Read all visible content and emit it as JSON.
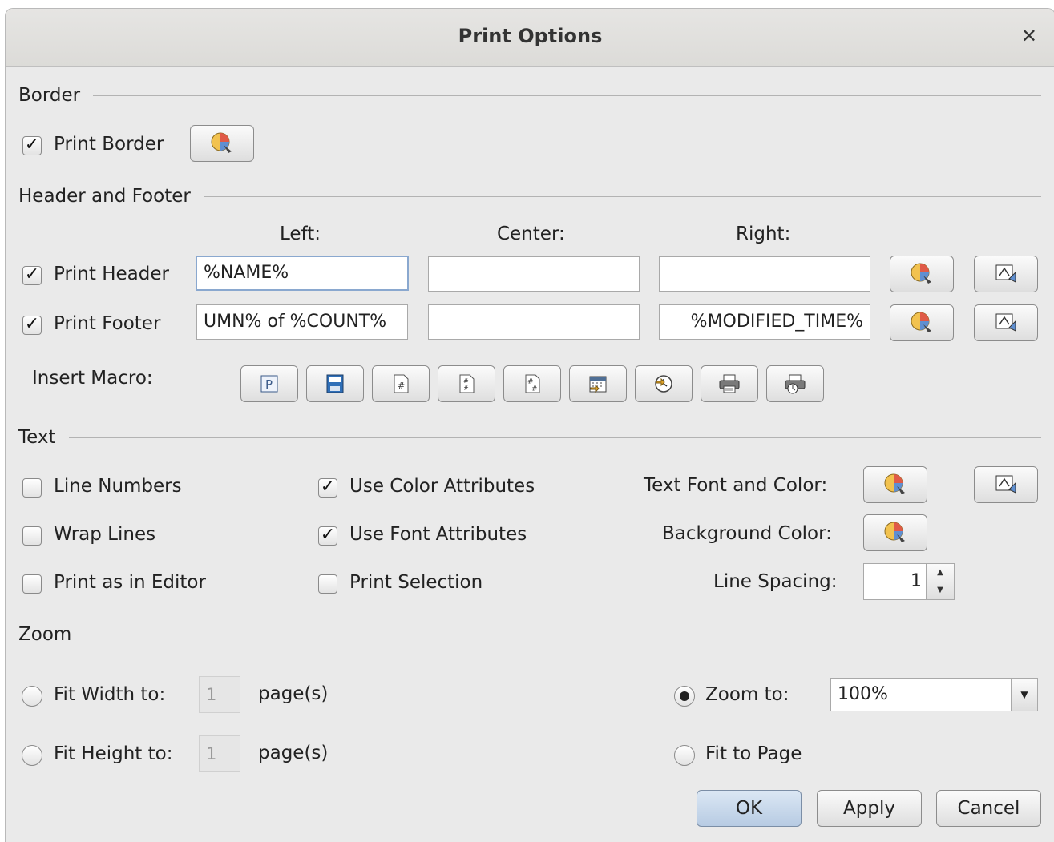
{
  "dialog": {
    "title": "Print Options",
    "close_glyph": "✕"
  },
  "border": {
    "section_label": "Border",
    "print_border": "Print Border",
    "print_border_checked": true
  },
  "header_footer": {
    "section_label": "Header and Footer",
    "col_left": "Left:",
    "col_center": "Center:",
    "col_right": "Right:",
    "print_header": "Print Header",
    "print_header_checked": true,
    "header_left": "%NAME%",
    "header_center": "",
    "header_right": "",
    "print_footer": "Print Footer",
    "print_footer_checked": true,
    "footer_left": "UMN% of %COUNT%",
    "footer_center": "",
    "footer_right": "%MODIFIED_TIME%",
    "insert_macro": "Insert Macro:",
    "macro_icons": [
      "macro-p-icon",
      "macro-save-icon",
      "macro-page-number-icon",
      "macro-page-count-icon",
      "macro-page-of-count-icon",
      "macro-date-icon",
      "macro-time-icon",
      "macro-print-date-icon",
      "macro-print-time-icon"
    ]
  },
  "text": {
    "section_label": "Text",
    "line_numbers": "Line Numbers",
    "line_numbers_checked": false,
    "wrap_lines": "Wrap Lines",
    "wrap_lines_checked": false,
    "print_as_editor": "Print as in Editor",
    "print_as_editor_checked": false,
    "use_color": "Use Color Attributes",
    "use_color_checked": true,
    "use_font": "Use Font Attributes",
    "use_font_checked": true,
    "print_selection": "Print Selection",
    "print_selection_checked": false,
    "text_font_color": "Text Font and Color:",
    "background_color": "Background Color:",
    "line_spacing": "Line Spacing:",
    "line_spacing_value": "1"
  },
  "zoom": {
    "section_label": "Zoom",
    "fit_width": "Fit Width to:",
    "fit_width_value": "1",
    "fit_height": "Fit Height to:",
    "fit_height_value": "1",
    "pages": "page(s)",
    "zoom_to": "Zoom to:",
    "zoom_value": "100%",
    "fit_to_page": "Fit to Page",
    "selected": "zoom_to"
  },
  "buttons": {
    "ok": "OK",
    "apply": "Apply",
    "cancel": "Cancel"
  },
  "check_glyph": "✓",
  "colors": {
    "accent_focus": "#8aa8cf",
    "primary_button": "#c6d6ea"
  }
}
